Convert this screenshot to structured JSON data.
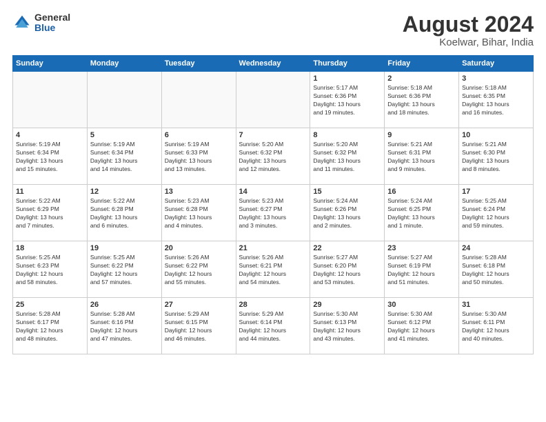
{
  "header": {
    "logo_general": "General",
    "logo_blue": "Blue",
    "main_title": "August 2024",
    "subtitle": "Koelwar, Bihar, India"
  },
  "days_of_week": [
    "Sunday",
    "Monday",
    "Tuesday",
    "Wednesday",
    "Thursday",
    "Friday",
    "Saturday"
  ],
  "weeks": [
    [
      {
        "day": "",
        "info": ""
      },
      {
        "day": "",
        "info": ""
      },
      {
        "day": "",
        "info": ""
      },
      {
        "day": "",
        "info": ""
      },
      {
        "day": "1",
        "info": "Sunrise: 5:17 AM\nSunset: 6:36 PM\nDaylight: 13 hours\nand 19 minutes."
      },
      {
        "day": "2",
        "info": "Sunrise: 5:18 AM\nSunset: 6:36 PM\nDaylight: 13 hours\nand 18 minutes."
      },
      {
        "day": "3",
        "info": "Sunrise: 5:18 AM\nSunset: 6:35 PM\nDaylight: 13 hours\nand 16 minutes."
      }
    ],
    [
      {
        "day": "4",
        "info": "Sunrise: 5:19 AM\nSunset: 6:34 PM\nDaylight: 13 hours\nand 15 minutes."
      },
      {
        "day": "5",
        "info": "Sunrise: 5:19 AM\nSunset: 6:34 PM\nDaylight: 13 hours\nand 14 minutes."
      },
      {
        "day": "6",
        "info": "Sunrise: 5:19 AM\nSunset: 6:33 PM\nDaylight: 13 hours\nand 13 minutes."
      },
      {
        "day": "7",
        "info": "Sunrise: 5:20 AM\nSunset: 6:32 PM\nDaylight: 13 hours\nand 12 minutes."
      },
      {
        "day": "8",
        "info": "Sunrise: 5:20 AM\nSunset: 6:32 PM\nDaylight: 13 hours\nand 11 minutes."
      },
      {
        "day": "9",
        "info": "Sunrise: 5:21 AM\nSunset: 6:31 PM\nDaylight: 13 hours\nand 9 minutes."
      },
      {
        "day": "10",
        "info": "Sunrise: 5:21 AM\nSunset: 6:30 PM\nDaylight: 13 hours\nand 8 minutes."
      }
    ],
    [
      {
        "day": "11",
        "info": "Sunrise: 5:22 AM\nSunset: 6:29 PM\nDaylight: 13 hours\nand 7 minutes."
      },
      {
        "day": "12",
        "info": "Sunrise: 5:22 AM\nSunset: 6:28 PM\nDaylight: 13 hours\nand 6 minutes."
      },
      {
        "day": "13",
        "info": "Sunrise: 5:23 AM\nSunset: 6:28 PM\nDaylight: 13 hours\nand 4 minutes."
      },
      {
        "day": "14",
        "info": "Sunrise: 5:23 AM\nSunset: 6:27 PM\nDaylight: 13 hours\nand 3 minutes."
      },
      {
        "day": "15",
        "info": "Sunrise: 5:24 AM\nSunset: 6:26 PM\nDaylight: 13 hours\nand 2 minutes."
      },
      {
        "day": "16",
        "info": "Sunrise: 5:24 AM\nSunset: 6:25 PM\nDaylight: 13 hours\nand 1 minute."
      },
      {
        "day": "17",
        "info": "Sunrise: 5:25 AM\nSunset: 6:24 PM\nDaylight: 12 hours\nand 59 minutes."
      }
    ],
    [
      {
        "day": "18",
        "info": "Sunrise: 5:25 AM\nSunset: 6:23 PM\nDaylight: 12 hours\nand 58 minutes."
      },
      {
        "day": "19",
        "info": "Sunrise: 5:25 AM\nSunset: 6:22 PM\nDaylight: 12 hours\nand 57 minutes."
      },
      {
        "day": "20",
        "info": "Sunrise: 5:26 AM\nSunset: 6:22 PM\nDaylight: 12 hours\nand 55 minutes."
      },
      {
        "day": "21",
        "info": "Sunrise: 5:26 AM\nSunset: 6:21 PM\nDaylight: 12 hours\nand 54 minutes."
      },
      {
        "day": "22",
        "info": "Sunrise: 5:27 AM\nSunset: 6:20 PM\nDaylight: 12 hours\nand 53 minutes."
      },
      {
        "day": "23",
        "info": "Sunrise: 5:27 AM\nSunset: 6:19 PM\nDaylight: 12 hours\nand 51 minutes."
      },
      {
        "day": "24",
        "info": "Sunrise: 5:28 AM\nSunset: 6:18 PM\nDaylight: 12 hours\nand 50 minutes."
      }
    ],
    [
      {
        "day": "25",
        "info": "Sunrise: 5:28 AM\nSunset: 6:17 PM\nDaylight: 12 hours\nand 48 minutes."
      },
      {
        "day": "26",
        "info": "Sunrise: 5:28 AM\nSunset: 6:16 PM\nDaylight: 12 hours\nand 47 minutes."
      },
      {
        "day": "27",
        "info": "Sunrise: 5:29 AM\nSunset: 6:15 PM\nDaylight: 12 hours\nand 46 minutes."
      },
      {
        "day": "28",
        "info": "Sunrise: 5:29 AM\nSunset: 6:14 PM\nDaylight: 12 hours\nand 44 minutes."
      },
      {
        "day": "29",
        "info": "Sunrise: 5:30 AM\nSunset: 6:13 PM\nDaylight: 12 hours\nand 43 minutes."
      },
      {
        "day": "30",
        "info": "Sunrise: 5:30 AM\nSunset: 6:12 PM\nDaylight: 12 hours\nand 41 minutes."
      },
      {
        "day": "31",
        "info": "Sunrise: 5:30 AM\nSunset: 6:11 PM\nDaylight: 12 hours\nand 40 minutes."
      }
    ]
  ]
}
